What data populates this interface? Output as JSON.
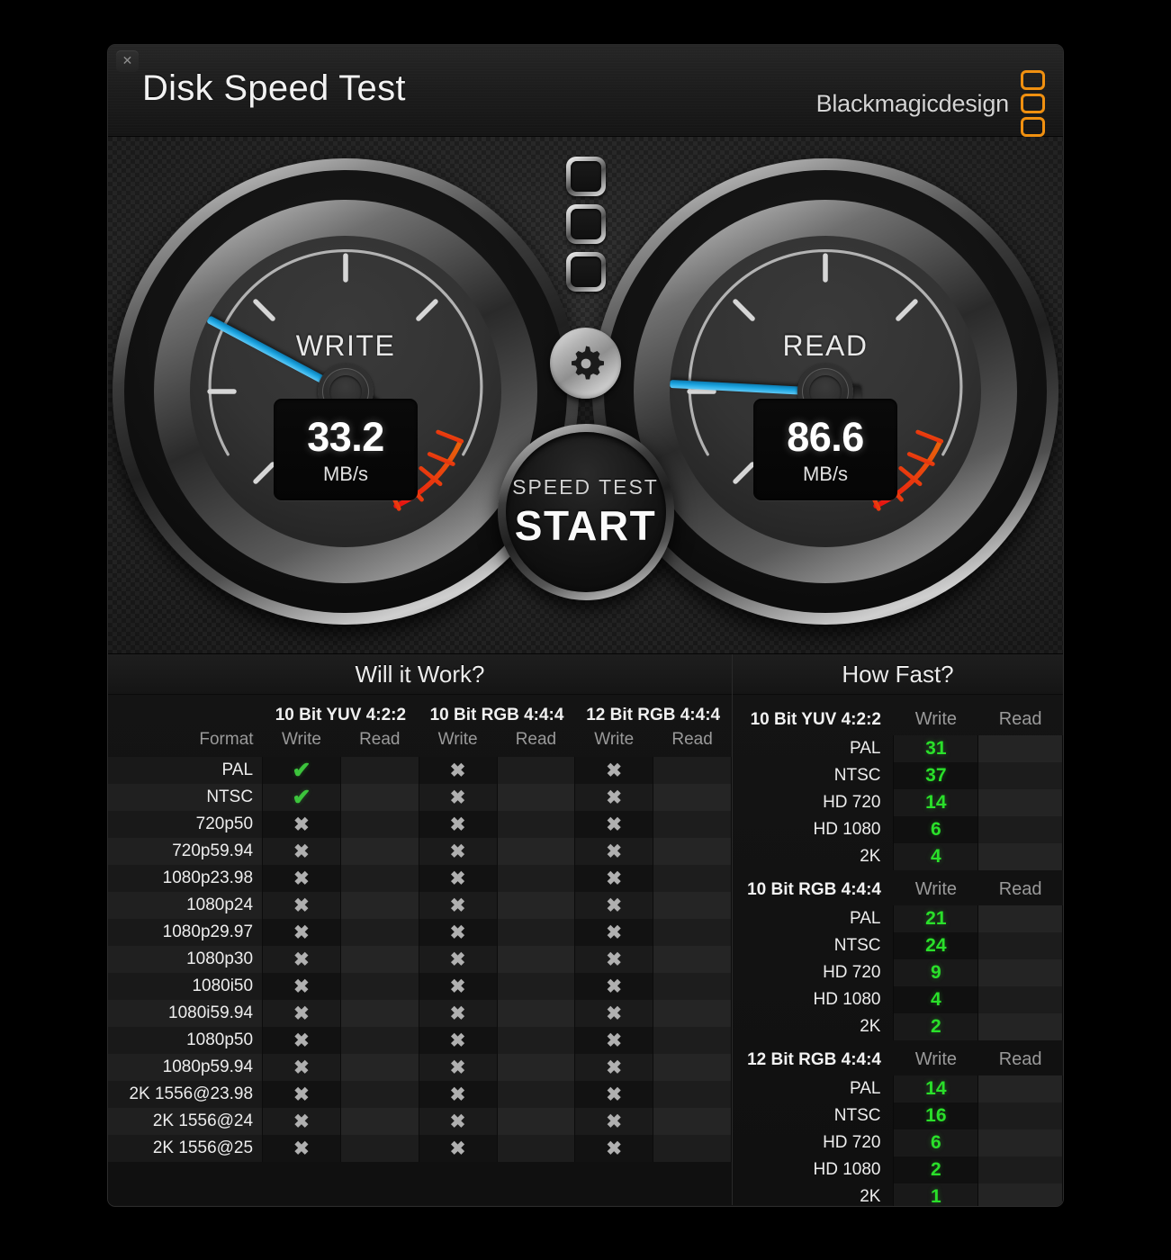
{
  "window": {
    "title": "Disk Speed Test",
    "close_label": "✕"
  },
  "brand": {
    "name": "Blackmagicdesign",
    "mark_color": "#f09010"
  },
  "gauges": {
    "write": {
      "label": "WRITE",
      "value": "33.2",
      "unit": "MB/s",
      "needle_angle_deg": 208,
      "needle_color": "#1ba4e0"
    },
    "read": {
      "label": "READ",
      "value": "86.6",
      "unit": "MB/s",
      "needle_angle_deg": 183,
      "needle_color": "#1ba4e0"
    }
  },
  "controls": {
    "indicator_light_count": 3,
    "settings_icon": "gear-icon",
    "start": {
      "sub_label": "SPEED TEST",
      "main_label": "START"
    }
  },
  "will_it_work": {
    "title": "Will it Work?",
    "format_header": "Format",
    "groups": [
      {
        "name": "10 Bit YUV 4:2:2",
        "write_label": "Write",
        "read_label": "Read"
      },
      {
        "name": "10 Bit RGB 4:4:4",
        "write_label": "Write",
        "read_label": "Read"
      },
      {
        "name": "12 Bit RGB 4:4:4",
        "write_label": "Write",
        "read_label": "Read"
      }
    ],
    "ok_mark": "✔",
    "no_mark": "✖",
    "rows": [
      {
        "format": "PAL",
        "cells": [
          "ok",
          "",
          "no",
          "",
          "no",
          ""
        ]
      },
      {
        "format": "NTSC",
        "cells": [
          "ok",
          "",
          "no",
          "",
          "no",
          ""
        ]
      },
      {
        "format": "720p50",
        "cells": [
          "no",
          "",
          "no",
          "",
          "no",
          ""
        ]
      },
      {
        "format": "720p59.94",
        "cells": [
          "no",
          "",
          "no",
          "",
          "no",
          ""
        ]
      },
      {
        "format": "1080p23.98",
        "cells": [
          "no",
          "",
          "no",
          "",
          "no",
          ""
        ]
      },
      {
        "format": "1080p24",
        "cells": [
          "no",
          "",
          "no",
          "",
          "no",
          ""
        ]
      },
      {
        "format": "1080p29.97",
        "cells": [
          "no",
          "",
          "no",
          "",
          "no",
          ""
        ]
      },
      {
        "format": "1080p30",
        "cells": [
          "no",
          "",
          "no",
          "",
          "no",
          ""
        ]
      },
      {
        "format": "1080i50",
        "cells": [
          "no",
          "",
          "no",
          "",
          "no",
          ""
        ]
      },
      {
        "format": "1080i59.94",
        "cells": [
          "no",
          "",
          "no",
          "",
          "no",
          ""
        ]
      },
      {
        "format": "1080p50",
        "cells": [
          "no",
          "",
          "no",
          "",
          "no",
          ""
        ]
      },
      {
        "format": "1080p59.94",
        "cells": [
          "no",
          "",
          "no",
          "",
          "no",
          ""
        ]
      },
      {
        "format": "2K 1556@23.98",
        "cells": [
          "no",
          "",
          "no",
          "",
          "no",
          ""
        ]
      },
      {
        "format": "2K 1556@24",
        "cells": [
          "no",
          "",
          "no",
          "",
          "no",
          ""
        ]
      },
      {
        "format": "2K 1556@25",
        "cells": [
          "no",
          "",
          "no",
          "",
          "no",
          ""
        ]
      }
    ]
  },
  "how_fast": {
    "title": "How Fast?",
    "write_label": "Write",
    "read_label": "Read",
    "value_color": "#2ae02a",
    "groups": [
      {
        "name": "10 Bit YUV 4:2:2",
        "rows": [
          {
            "label": "PAL",
            "write": "31",
            "read": ""
          },
          {
            "label": "NTSC",
            "write": "37",
            "read": ""
          },
          {
            "label": "HD 720",
            "write": "14",
            "read": ""
          },
          {
            "label": "HD 1080",
            "write": "6",
            "read": ""
          },
          {
            "label": "2K",
            "write": "4",
            "read": ""
          }
        ]
      },
      {
        "name": "10 Bit RGB 4:4:4",
        "rows": [
          {
            "label": "PAL",
            "write": "21",
            "read": ""
          },
          {
            "label": "NTSC",
            "write": "24",
            "read": ""
          },
          {
            "label": "HD 720",
            "write": "9",
            "read": ""
          },
          {
            "label": "HD 1080",
            "write": "4",
            "read": ""
          },
          {
            "label": "2K",
            "write": "2",
            "read": ""
          }
        ]
      },
      {
        "name": "12 Bit RGB 4:4:4",
        "rows": [
          {
            "label": "PAL",
            "write": "14",
            "read": ""
          },
          {
            "label": "NTSC",
            "write": "16",
            "read": ""
          },
          {
            "label": "HD 720",
            "write": "6",
            "read": ""
          },
          {
            "label": "HD 1080",
            "write": "2",
            "read": ""
          },
          {
            "label": "2K",
            "write": "1",
            "read": ""
          }
        ]
      }
    ]
  }
}
